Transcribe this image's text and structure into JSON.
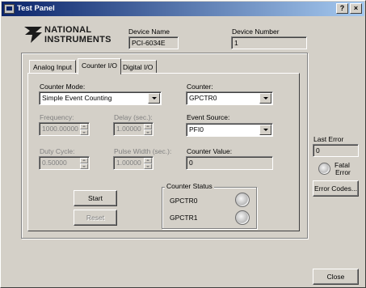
{
  "window": {
    "title": "Test Panel",
    "help_glyph": "?",
    "close_glyph": "×"
  },
  "header": {
    "logo_line1": "NATIONAL",
    "logo_line2": "INSTRUMENTS",
    "logo_icon": "eagle-logo-icon",
    "device_name_label": "Device Name",
    "device_name_value": "PCI-6034E",
    "device_number_label": "Device Number",
    "device_number_value": "1"
  },
  "tabs": [
    {
      "label": "Analog Input",
      "active": false
    },
    {
      "label": "Counter I/O",
      "active": true
    },
    {
      "label": "Digital I/O",
      "active": false
    }
  ],
  "counter_io": {
    "counter_mode_label": "Counter Mode:",
    "counter_mode_value": "Simple Event Counting",
    "counter_label": "Counter:",
    "counter_value": "GPCTR0",
    "frequency_label": "Frequency:",
    "frequency_value": "1000.00000",
    "delay_label": "Delay (sec.):",
    "delay_value": "1.00000",
    "event_source_label": "Event Source:",
    "event_source_value": "PFI0",
    "duty_cycle_label": "Duty Cycle:",
    "duty_cycle_value": "0.50000",
    "pulse_width_label": "Pulse Width (sec.):",
    "pulse_width_value": "1.00000",
    "counter_value_label": "Counter Value:",
    "counter_value_value": "0",
    "start_label": "Start",
    "reset_label": "Reset",
    "counter_status_label": "Counter Status",
    "status_gpctr0_label": "GPCTR0",
    "status_gpctr1_label": "GPCTR1"
  },
  "side_panel": {
    "last_error_label": "Last Error",
    "last_error_value": "0",
    "fatal_error_label_line1": "Fatal",
    "fatal_error_label_line2": "Error",
    "error_codes_label": "Error Codes...",
    "close_label": "Close"
  },
  "colors": {
    "title_bar_start": "#0a246a",
    "title_bar_end": "#a6caf0",
    "face": "#d4d0c8",
    "disabled_text": "#808080"
  }
}
